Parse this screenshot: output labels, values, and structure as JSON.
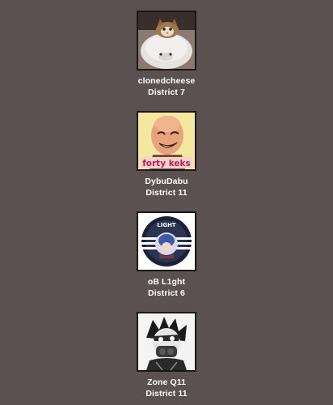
{
  "players": [
    {
      "name": "clonedcheese",
      "district": "District 7",
      "avatar": "cat-on-seal-pillow"
    },
    {
      "name": "DybuDabu",
      "district": "District 11",
      "avatar": "forty-keks-meme",
      "avatar_text": "forty keks"
    },
    {
      "name": "oB L1ght",
      "district": "District 6",
      "avatar": "light-circle-logo",
      "avatar_text": "LIGHT"
    },
    {
      "name": "Zone Q11",
      "district": "District 11",
      "avatar": "gasmask-anime-character"
    }
  ],
  "colors": {
    "background": "#5b5150",
    "text": "#ffffff"
  }
}
